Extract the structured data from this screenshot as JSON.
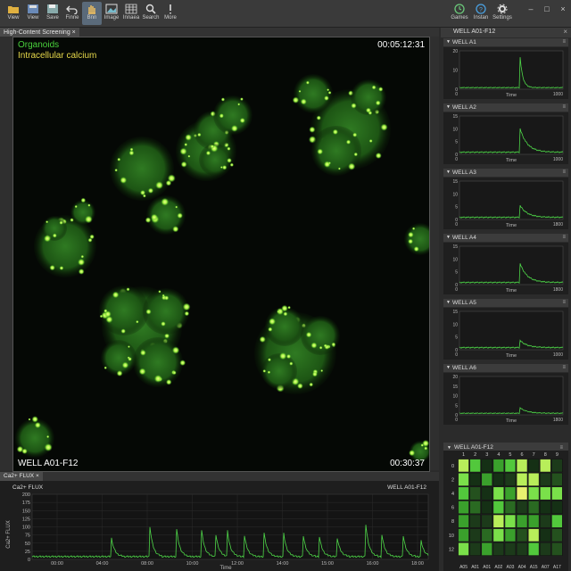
{
  "toolbar": {
    "items": [
      {
        "label": "View",
        "icon": "folder-icon"
      },
      {
        "label": "View",
        "icon": "save-view-icon"
      },
      {
        "label": "Save",
        "icon": "save-icon"
      },
      {
        "label": "Finne",
        "icon": "undo-icon"
      },
      {
        "label": "Bnn",
        "icon": "hand-icon"
      },
      {
        "label": "Image",
        "icon": "image-icon"
      },
      {
        "label": "Innaea",
        "icon": "grid-icon"
      },
      {
        "label": "Search",
        "icon": "search-icon"
      },
      {
        "label": "More",
        "icon": "more-icon"
      }
    ],
    "right": [
      {
        "label": "Games",
        "icon": "clock-icon"
      },
      {
        "label": "Instan",
        "icon": "help-icon"
      },
      {
        "label": "Settings",
        "icon": "gear-icon"
      }
    ]
  },
  "viewer": {
    "tab_label": "High-Content Screening",
    "overlay_line1": "Organoids",
    "overlay_line2": "Intracellular calcium",
    "timestamp_top": "00:05:12:31",
    "well_label": "WELL A01-F12",
    "timestamp_bottom": "00:30:37",
    "colors": {
      "organoids": "#49d13c",
      "calcium": "#e6d84a"
    }
  },
  "flux": {
    "tab_label": "Ca2+ FLUX",
    "title": "Ca2+ FLUX",
    "well": "WELL A01-F12",
    "ylabel": "Ca2+ FLUX",
    "xlabel": "Time",
    "yticks": [
      "200",
      "175",
      "150",
      "125",
      "100",
      "75",
      "50",
      "25",
      "0"
    ],
    "xticks": [
      "00:00",
      "04:00",
      "08:00",
      "10:00",
      "12:00",
      "14:00",
      "15:00",
      "16:00",
      "18:00"
    ]
  },
  "right_panel": {
    "tab_label": "WELL A01-F12",
    "wells": [
      {
        "name": "WELL A1",
        "ymax": "20",
        "yticks": [
          "20",
          "10",
          "0"
        ],
        "xend": "1000",
        "peak": 20,
        "start": 0
      },
      {
        "name": "WELL A2",
        "ymax": "15",
        "yticks": [
          "15",
          "10",
          "5",
          "0"
        ],
        "xend": "1000",
        "peak": 10,
        "start": 0
      },
      {
        "name": "WELL A3",
        "ymax": "15",
        "yticks": [
          "15",
          "10",
          "5",
          "0"
        ],
        "xend": "1800",
        "peak": 5,
        "start": 0
      },
      {
        "name": "WELL A4",
        "ymax": "15",
        "yticks": [
          "15",
          "10",
          "5",
          "0"
        ],
        "xend": "1800",
        "peak": 8,
        "start": 0
      },
      {
        "name": "WELL A5",
        "ymax": "15",
        "yticks": [
          "15",
          "10",
          "5",
          "0"
        ],
        "xend": "1000",
        "peak": 3,
        "start": 0
      },
      {
        "name": "WELL A6",
        "ymax": "20",
        "yticks": [
          "20",
          "15",
          "10",
          "5",
          "0"
        ],
        "xend": "1800",
        "peak": 3,
        "start": 0
      }
    ],
    "time_label": "Time",
    "plate": {
      "title": "WELL A01-F12",
      "cols": [
        "1",
        "2",
        "3",
        "4",
        "5",
        "6",
        "7",
        "8",
        "9"
      ],
      "rows": [
        "0",
        "2",
        "4",
        "6",
        "8",
        "10",
        "12"
      ],
      "xlabels": [
        "A05",
        "A01",
        "A01",
        "A02",
        "A03",
        "A04",
        "A15",
        "A07",
        "A17"
      ]
    }
  }
}
